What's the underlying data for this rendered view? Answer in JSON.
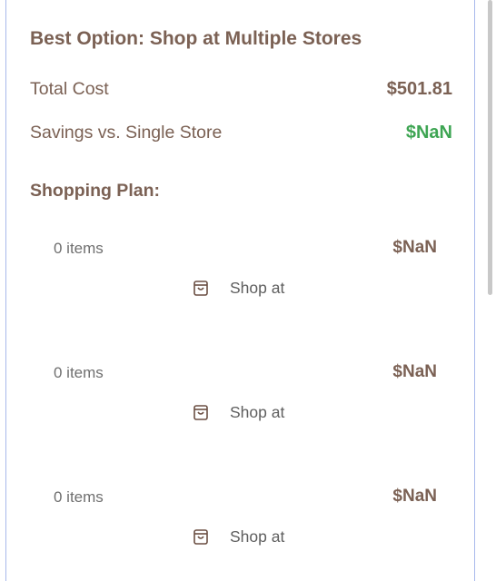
{
  "summary": {
    "title": "Best Option: Shop at Multiple Stores",
    "total_cost_label": "Total Cost",
    "total_cost_value": "$501.81",
    "savings_label": "Savings vs. Single Store",
    "savings_value": "$NaN"
  },
  "plan": {
    "title": "Shopping Plan:",
    "stores": [
      {
        "items_text": "0 items",
        "cost": "$NaN",
        "shop_label": "Shop at",
        "icon": "shopping-bag-icon"
      },
      {
        "items_text": "0 items",
        "cost": "$NaN",
        "shop_label": "Shop at",
        "icon": "shopping-bag-icon"
      },
      {
        "items_text": "0 items",
        "cost": "$NaN",
        "shop_label": "Shop at",
        "icon": "shopping-bag-icon"
      }
    ]
  },
  "colors": {
    "border": "#a9b9ec",
    "text_brown": "#7b6154",
    "savings_green": "#3ea553"
  }
}
